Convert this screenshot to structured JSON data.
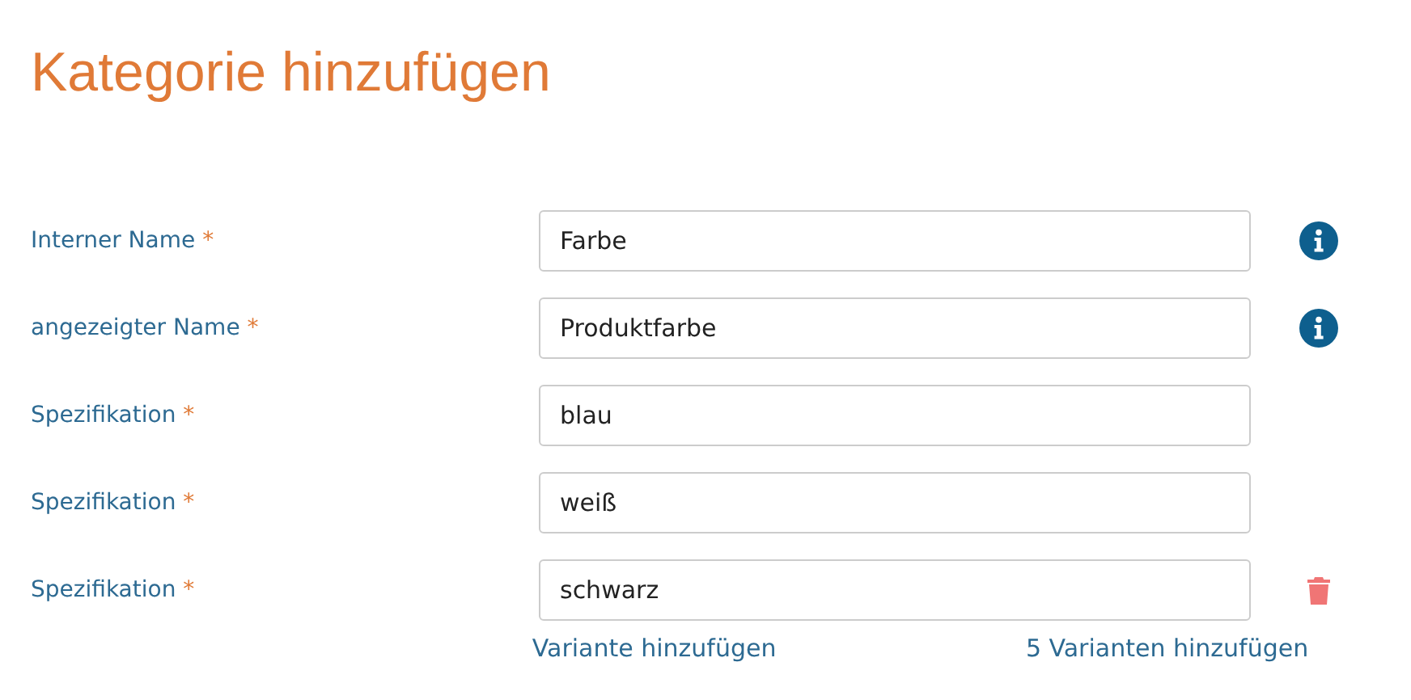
{
  "title": "Kategorie hinzufügen",
  "fields": [
    {
      "kind": "info",
      "label": "Interner Name",
      "mark": "*",
      "value": "Farbe"
    },
    {
      "kind": "info",
      "label": "angezeigter Name",
      "mark": "*",
      "value": "Produktfarbe"
    },
    {
      "kind": "plain",
      "label": "Spezifikation",
      "mark": "*",
      "value": "blau"
    },
    {
      "kind": "plain",
      "label": "Spezifikation",
      "mark": "*",
      "value": "weiß"
    },
    {
      "kind": "removable",
      "label": "Spezifikation",
      "mark": "*",
      "value": "schwarz"
    }
  ],
  "links": [
    "Variante hinzufügen",
    "5 Varianten hinzufügen"
  ]
}
